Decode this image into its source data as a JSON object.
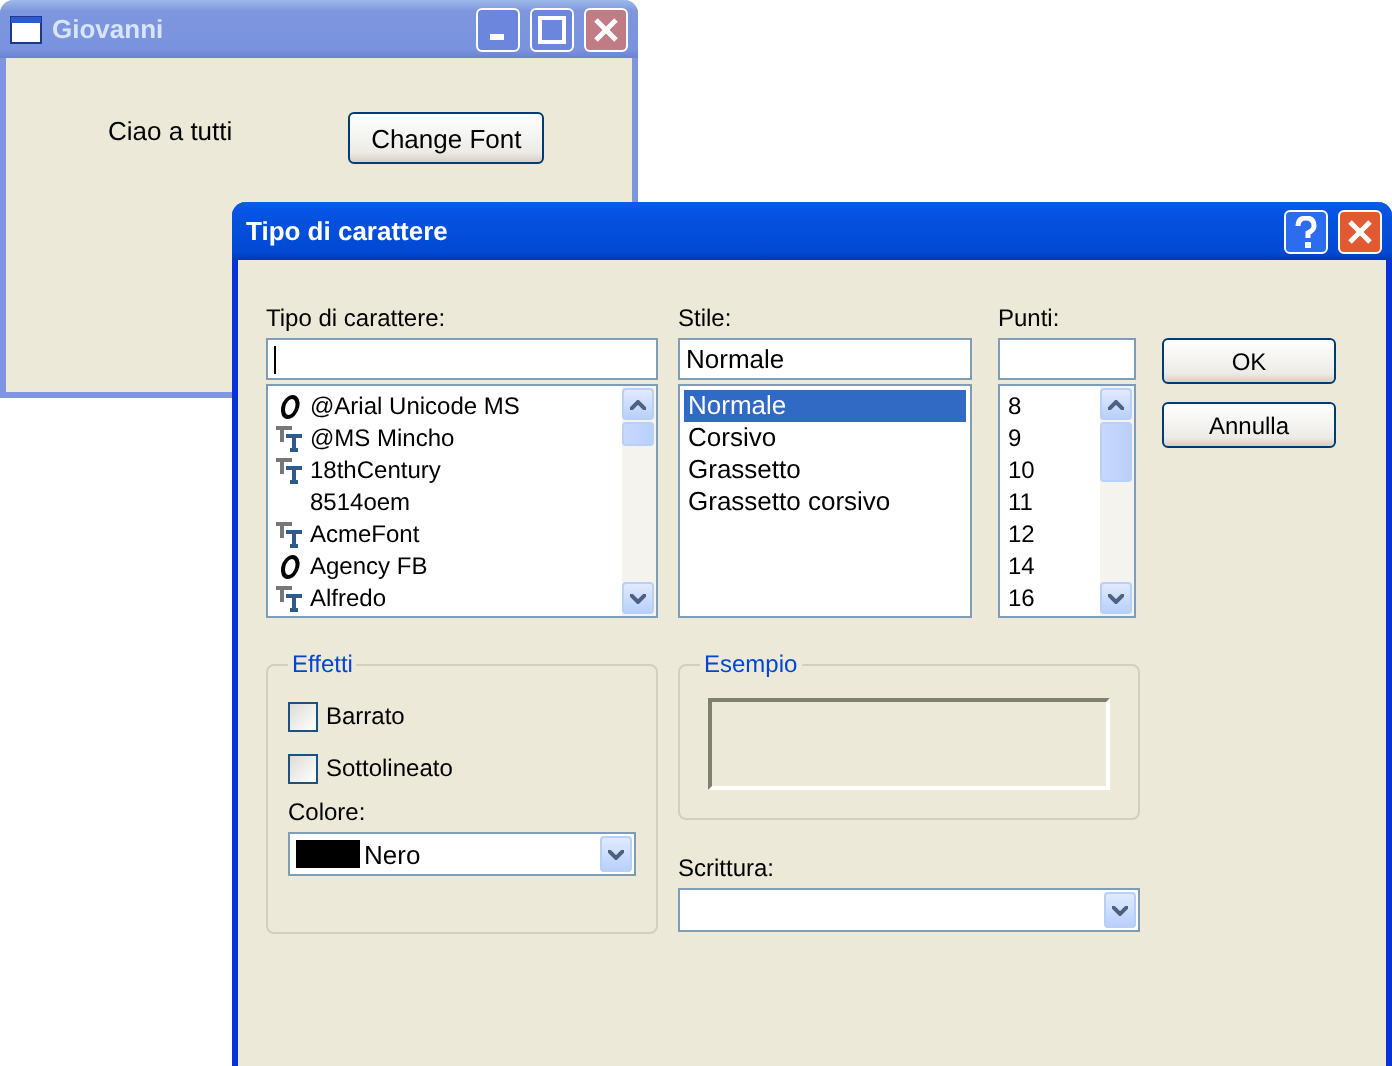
{
  "main_window": {
    "title": "Giovanni",
    "label": "Ciao a tutti",
    "button": "Change Font"
  },
  "dialog": {
    "title": "Tipo di carattere",
    "font": {
      "label": "Tipo di carattere:",
      "items": [
        {
          "name": "@Arial Unicode MS",
          "kind": "opentype",
          "selected": false
        },
        {
          "name": "@MS Mincho",
          "kind": "truetype",
          "selected": false
        },
        {
          "name": "18thCentury",
          "kind": "truetype",
          "selected": false
        },
        {
          "name": "8514oem",
          "kind": "raster",
          "selected": false
        },
        {
          "name": "AcmeFont",
          "kind": "truetype",
          "selected": false
        },
        {
          "name": "Agency FB",
          "kind": "opentype",
          "selected": false
        },
        {
          "name": "Alfredo",
          "kind": "truetype",
          "selected": false
        }
      ]
    },
    "style": {
      "label": "Stile:",
      "value": "Normale",
      "items": [
        {
          "name": "Normale",
          "selected": true
        },
        {
          "name": "Corsivo",
          "selected": false
        },
        {
          "name": "Grassetto",
          "selected": false
        },
        {
          "name": "Grassetto corsivo",
          "selected": false
        }
      ]
    },
    "size": {
      "label": "Punti:",
      "items": [
        {
          "name": "8",
          "selected": false
        },
        {
          "name": "9",
          "selected": false
        },
        {
          "name": "10",
          "selected": false
        },
        {
          "name": "11",
          "selected": false
        },
        {
          "name": "12",
          "selected": false
        },
        {
          "name": "14",
          "selected": false
        },
        {
          "name": "16",
          "selected": false
        }
      ]
    },
    "buttons": [
      "OK",
      "Annulla"
    ],
    "effects": {
      "title": "Effetti",
      "checkboxes": [
        {
          "label": "Barrato",
          "checked": false
        },
        {
          "label": "Sottolineato",
          "checked": false
        }
      ],
      "color_label": "Colore:",
      "color": {
        "name": "Nero",
        "color": "#000000"
      }
    },
    "sample": {
      "title": "Esempio"
    },
    "script": {
      "label": "Scrittura:"
    }
  }
}
